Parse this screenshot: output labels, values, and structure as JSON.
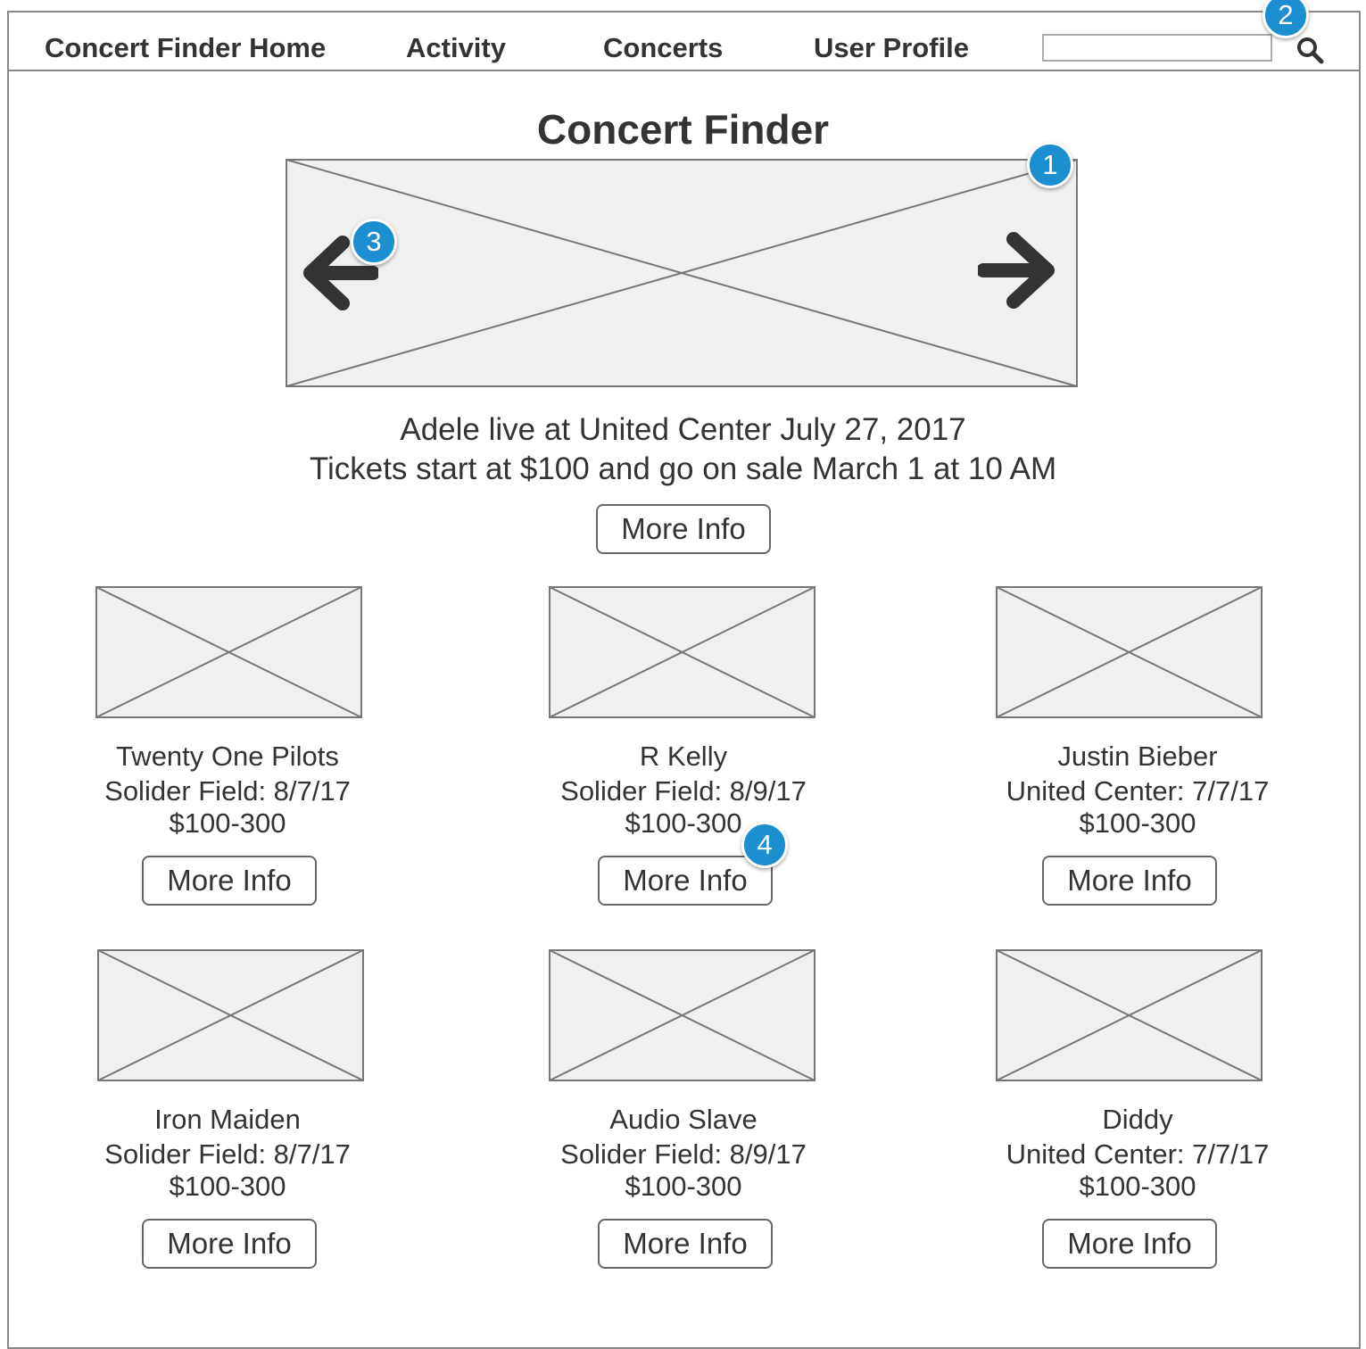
{
  "nav": {
    "items": [
      {
        "label": "Concert Finder Home"
      },
      {
        "label": "Activity"
      },
      {
        "label": "Concerts"
      },
      {
        "label": "User Profile"
      }
    ],
    "search": {
      "value": "",
      "placeholder": ""
    }
  },
  "title": "Concert Finder",
  "hero": {
    "line1": "Adele live at United Center July 27, 2017",
    "line2": "Tickets start at $100 and go on sale March 1 at 10 AM",
    "button_label": "More Info"
  },
  "concerts": [
    {
      "name": "Twenty One Pilots",
      "venue_date": "Solider Field: 8/7/17",
      "price": "$100-300",
      "button_label": "More Info"
    },
    {
      "name": "R Kelly",
      "venue_date": "Solider Field: 8/9/17",
      "price": "$100-300",
      "button_label": "More Info"
    },
    {
      "name": "Justin Bieber",
      "venue_date": "United Center: 7/7/17",
      "price": "$100-300",
      "button_label": "More Info"
    },
    {
      "name": "Iron Maiden",
      "venue_date": "Solider Field: 8/7/17",
      "price": "$100-300",
      "button_label": "More Info"
    },
    {
      "name": "Audio Slave",
      "venue_date": "Solider Field: 8/9/17",
      "price": "$100-300",
      "button_label": "More Info"
    },
    {
      "name": "Diddy",
      "venue_date": "United Center: 7/7/17",
      "price": "$100-300",
      "button_label": "More Info"
    }
  ],
  "annotations": [
    "1",
    "2",
    "3",
    "4"
  ],
  "icons": {
    "search": "search-icon",
    "prev": "arrow-left-icon",
    "next": "arrow-right-icon"
  },
  "colors": {
    "marker": "#1b8fcf",
    "placeholder_fill": "#f0f0f0",
    "border": "#888888"
  }
}
